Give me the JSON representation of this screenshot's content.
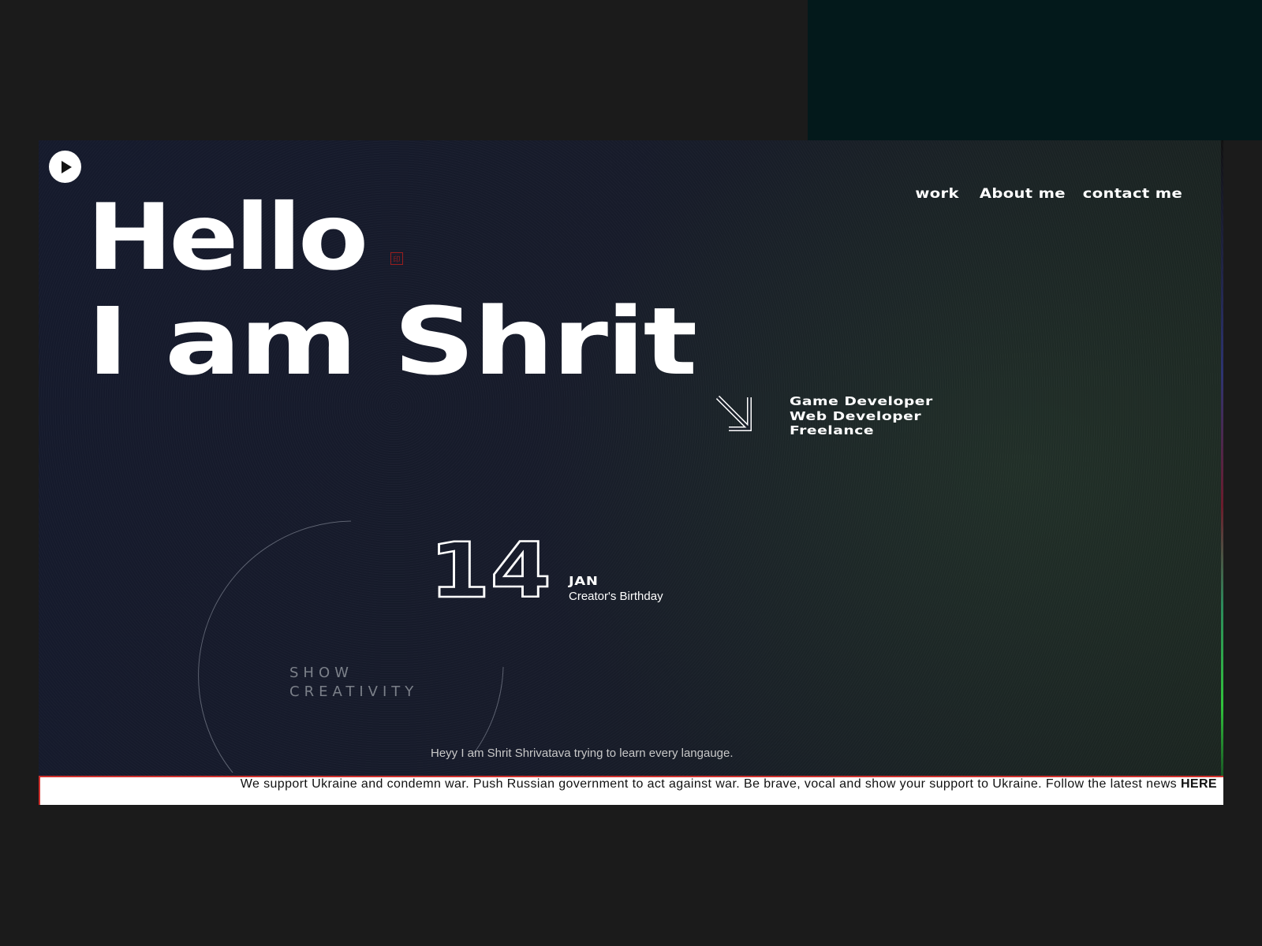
{
  "nav": {
    "items": [
      "work",
      "About me",
      "contact me"
    ]
  },
  "hero": {
    "line1": "Hello",
    "line2": "I am Shrit",
    "seal_glyph": "印"
  },
  "roles": [
    "Game Developer",
    "Web Developer",
    "Freelance"
  ],
  "decor": {
    "tagline_1": "SHOW",
    "tagline_2": "CREATIVITY"
  },
  "date": {
    "day": "14",
    "month": "JAN",
    "caption": "Creator's Birthday"
  },
  "intro": "Heyy I am Shrit Shrivatava trying to learn every langauge.",
  "banner": {
    "text": "We support Ukraine and condemn war. Push Russian government to act against war. Be brave, vocal and show your support to Ukraine. Follow the latest news",
    "link": "HERE"
  },
  "colors": {
    "page_bg": "#1b1b1b",
    "teal_block": "#03191b",
    "banner_border": "#d0312d",
    "accent_red": "#9a1c1c"
  },
  "icons": [
    "play-icon",
    "arrow-down-right-icon",
    "seal-icon"
  ]
}
